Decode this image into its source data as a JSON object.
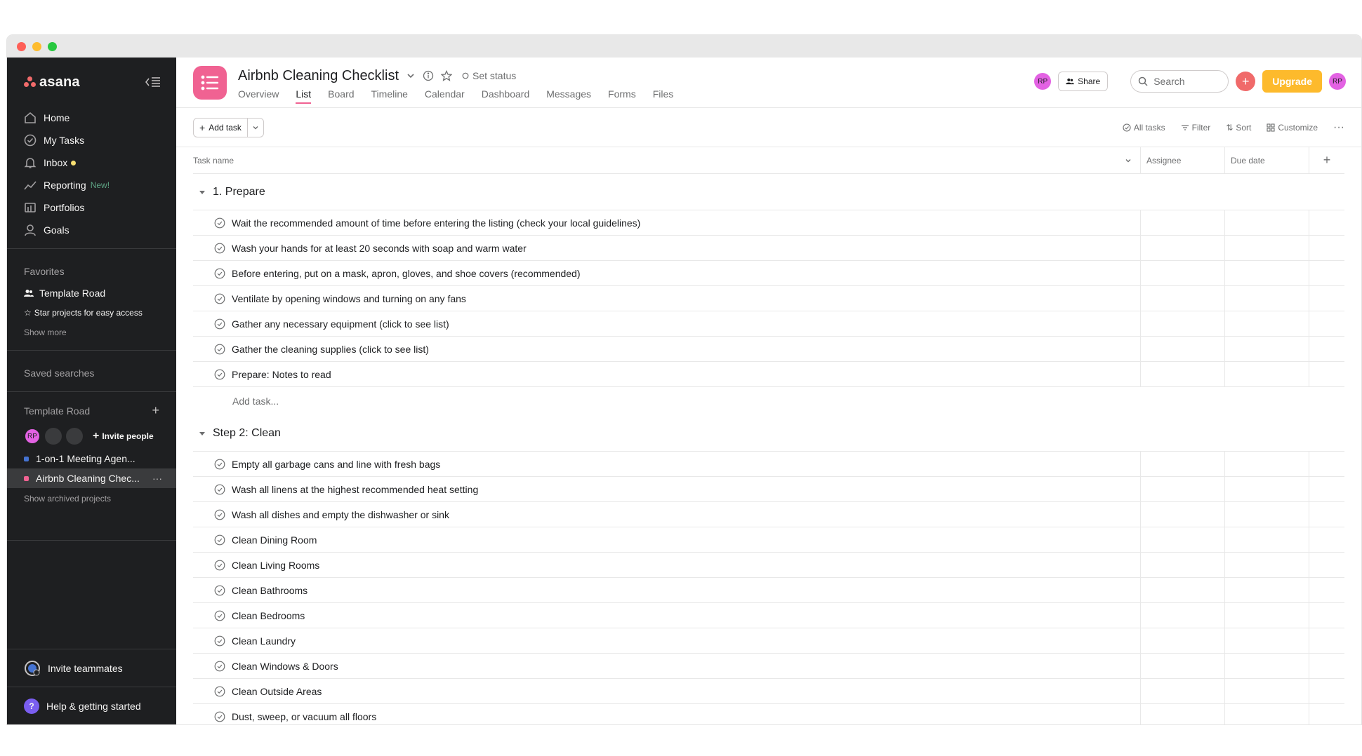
{
  "sidebar": {
    "logo_text": "asana",
    "nav": [
      {
        "label": "Home",
        "icon": "home-icon"
      },
      {
        "label": "My Tasks",
        "icon": "check-circle-icon"
      },
      {
        "label": "Inbox",
        "icon": "bell-icon"
      },
      {
        "label": "Reporting",
        "icon": "chart-line-icon",
        "badge": "New!"
      },
      {
        "label": "Portfolios",
        "icon": "portfolio-icon"
      },
      {
        "label": "Goals",
        "icon": "person-icon"
      }
    ],
    "favorites_title": "Favorites",
    "favorite_item": "Template Road",
    "star_hint": "Star projects for easy access",
    "show_more": "Show more",
    "saved_searches": "Saved searches",
    "team_title": "Template Road",
    "avatar_initials": "RP",
    "invite_people": "Invite people",
    "projects": [
      {
        "label": "1-on-1 Meeting Agen...",
        "color": "#4573d2"
      },
      {
        "label": "Airbnb Cleaning Chec...",
        "color": "#f06292",
        "active": true
      }
    ],
    "show_archived": "Show archived projects",
    "invite_teammates": "Invite teammates",
    "help": "Help & getting started",
    "help_icon_glyph": "?"
  },
  "header": {
    "title": "Airbnb Cleaning Checklist",
    "set_status": "Set status",
    "tabs": [
      "Overview",
      "List",
      "Board",
      "Timeline",
      "Calendar",
      "Dashboard",
      "Messages",
      "Forms",
      "Files"
    ],
    "active_tab": "List",
    "member_initials": "RP",
    "share": "Share",
    "search_placeholder": "Search",
    "plus_glyph": "+",
    "upgrade": "Upgrade",
    "user_initials": "RP"
  },
  "toolbar": {
    "add_task": "Add task",
    "all_tasks": "All tasks",
    "filter": "Filter",
    "sort": "Sort",
    "customize": "Customize",
    "more_glyph": "···"
  },
  "columns": {
    "task_name": "Task name",
    "assignee": "Assignee",
    "due_date": "Due date",
    "add_glyph": "+"
  },
  "sections": [
    {
      "title": "1. Prepare",
      "tasks": [
        "Wait the recommended amount of time before entering the listing (check your local guidelines)",
        "Wash your hands for at least 20 seconds with soap and warm water",
        "Before entering, put on a mask, apron, gloves, and shoe covers (recommended)",
        "Ventilate by opening windows and turning on any fans",
        "Gather any necessary equipment (click to see list)",
        "Gather the cleaning supplies (click to see list)",
        "Prepare: Notes to read"
      ],
      "add_task": "Add task..."
    },
    {
      "title": "Step 2: Clean",
      "tasks": [
        "Empty all garbage cans and line with fresh bags",
        "Wash all linens at the highest recommended heat setting",
        "Wash all dishes and empty the dishwasher or sink",
        "Clean Dining Room",
        "Clean Living Rooms",
        "Clean Bathrooms",
        "Clean Bedrooms",
        "Clean Laundry",
        "Clean Windows & Doors",
        "Clean Outside Areas",
        "Dust, sweep, or vacuum all floors"
      ]
    }
  ],
  "colors": {
    "sidebar_bg": "#1e1f21",
    "accent_pink": "#f06292",
    "upgrade": "#fdba2c",
    "plus": "#f06a6a",
    "avatar_pink": "#e362e3"
  }
}
